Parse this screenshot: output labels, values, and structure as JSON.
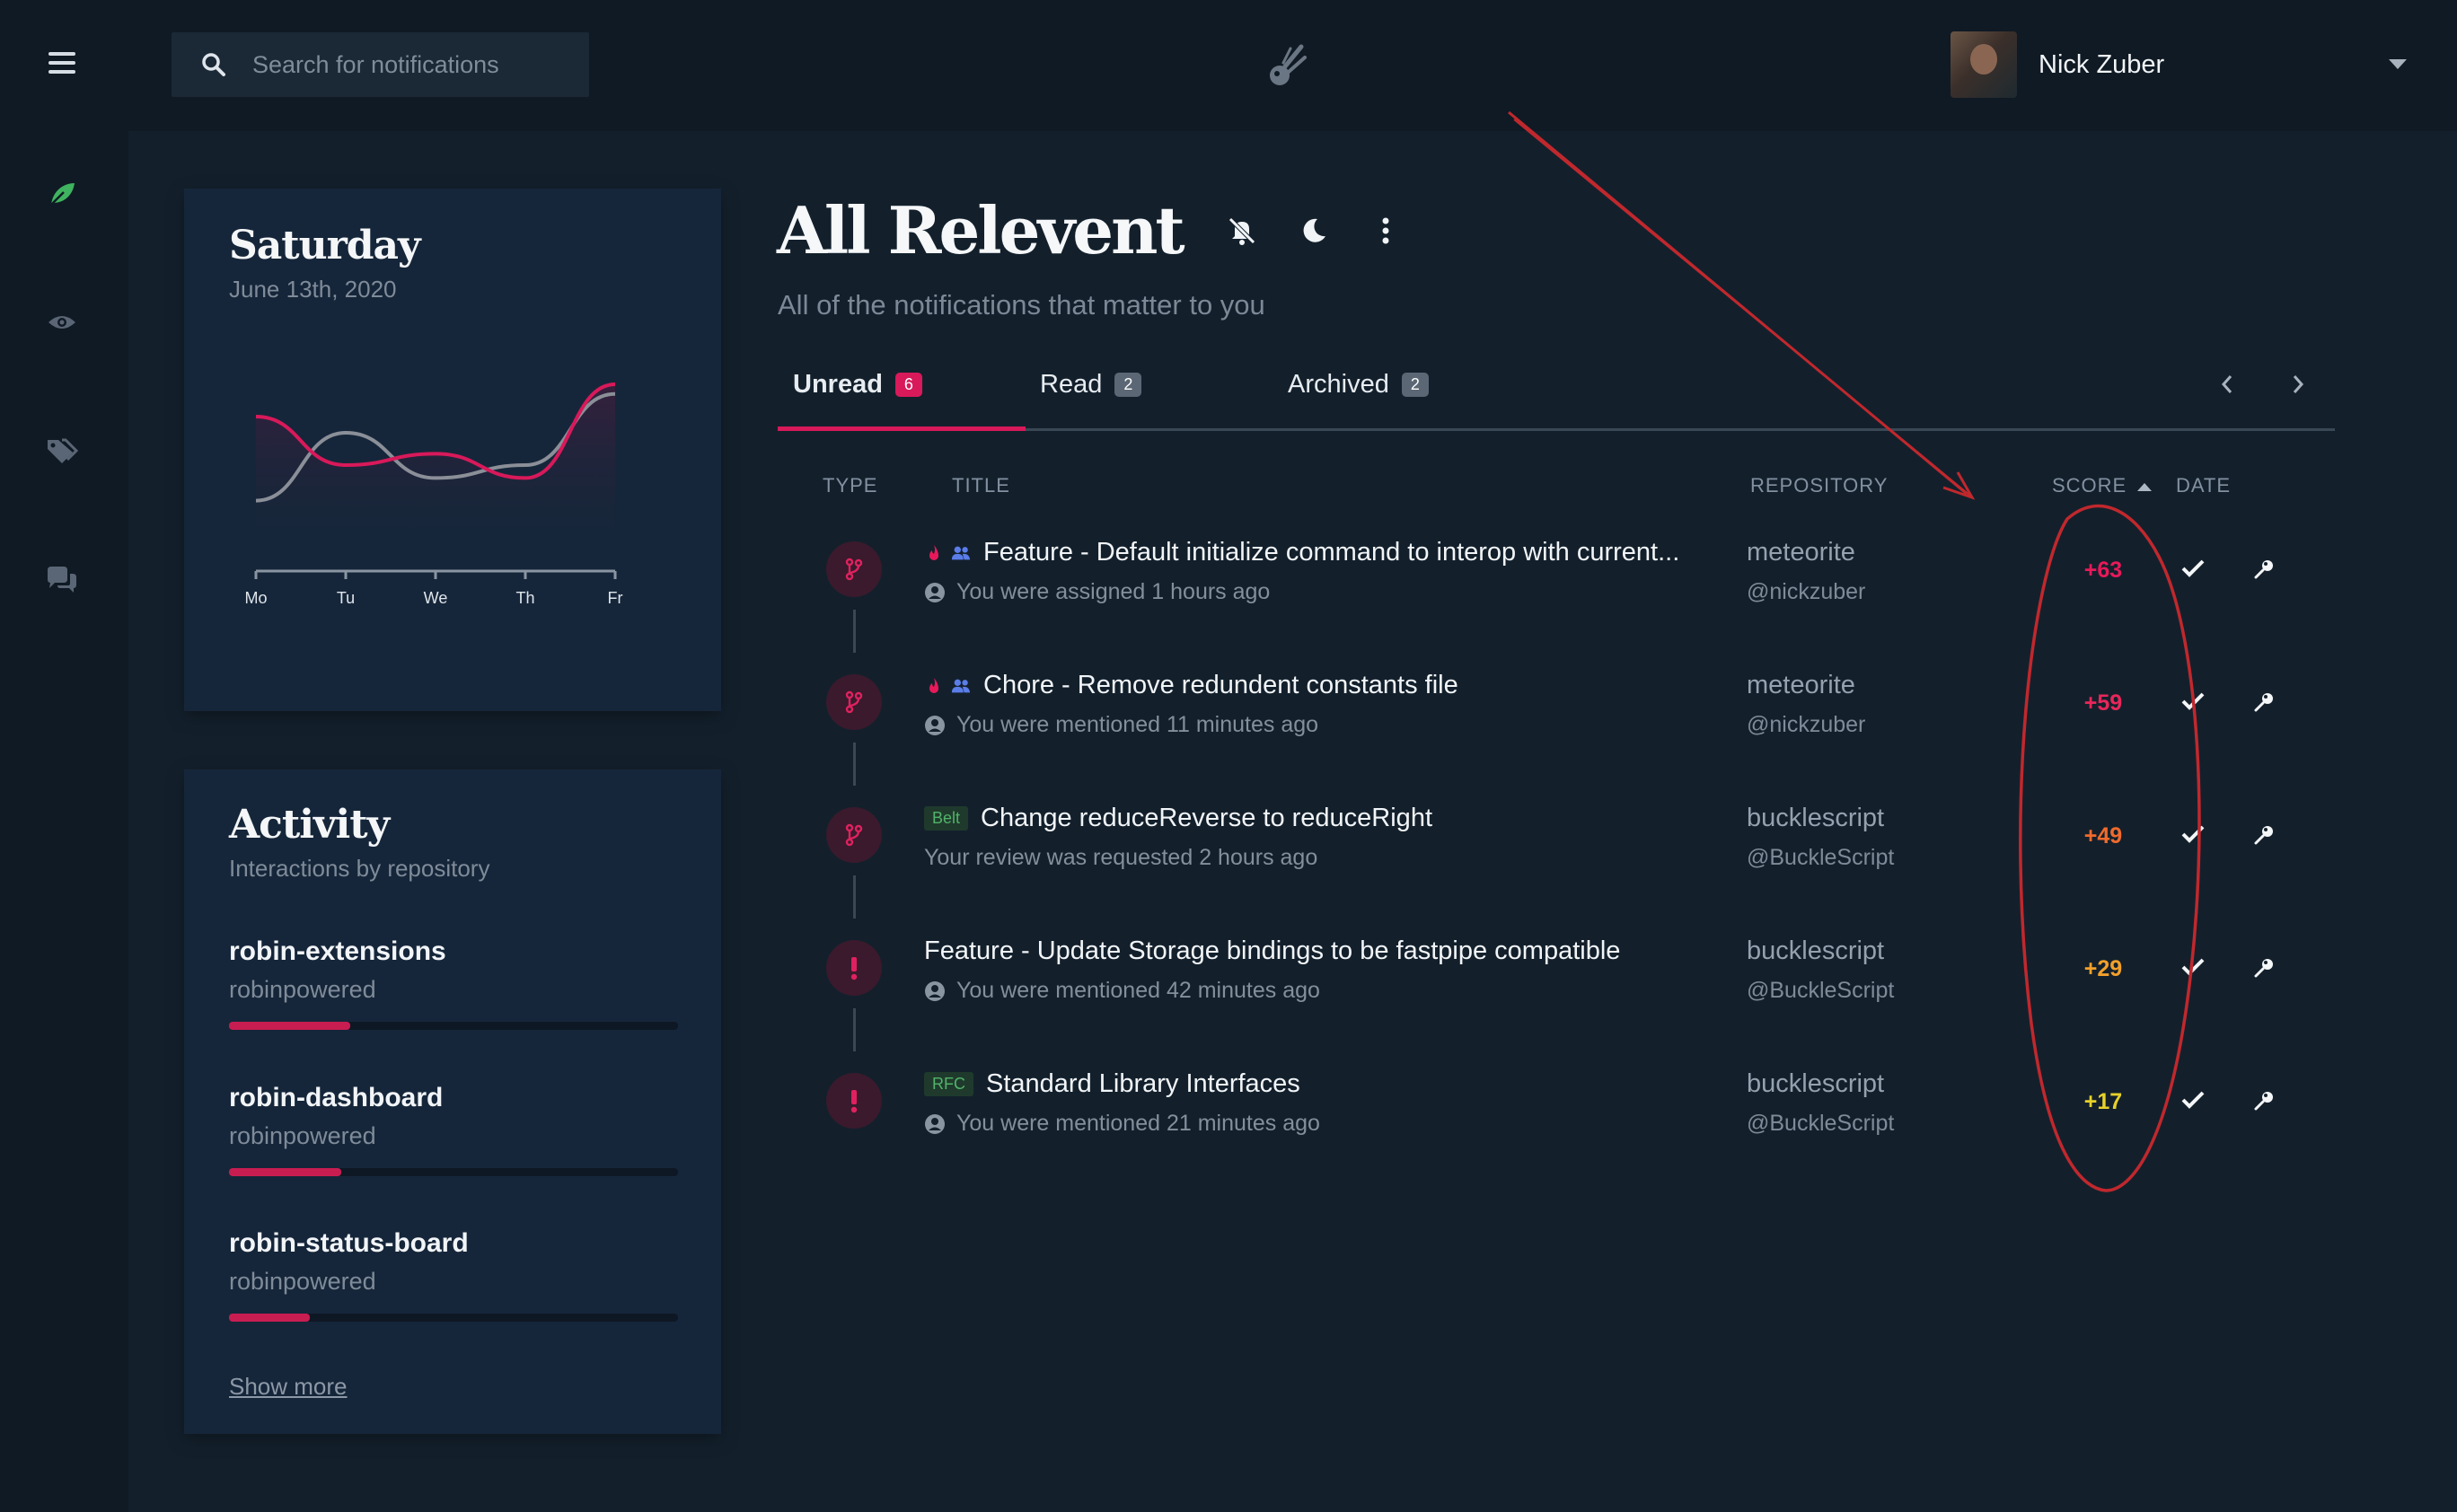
{
  "search": {
    "placeholder": "Search for notifications"
  },
  "user": {
    "name": "Nick Zuber"
  },
  "sidebar": {
    "icons": [
      "menu-icon",
      "leaf-icon",
      "eye-icon",
      "tags-icon",
      "chat-icon"
    ]
  },
  "weekday_card": {
    "day": "Saturday",
    "date": "June 13th, 2020",
    "chart_data": {
      "type": "line",
      "categories": [
        "Mo",
        "Tu",
        "We",
        "Th",
        "Fr"
      ],
      "series": [
        {
          "color": "#d8195a",
          "values": [
            70,
            40,
            47,
            32,
            90
          ]
        },
        {
          "color": "#8a8f98",
          "values": [
            18,
            60,
            32,
            40,
            84
          ]
        }
      ]
    }
  },
  "activity": {
    "title": "Activity",
    "subtitle": "Interactions by repository",
    "repos": [
      {
        "name": "robin-extensions",
        "org": "robinpowered",
        "progress": 0.27
      },
      {
        "name": "robin-dashboard",
        "org": "robinpowered",
        "progress": 0.25
      },
      {
        "name": "robin-status-board",
        "org": "robinpowered",
        "progress": 0.18
      }
    ],
    "show_more": "Show more"
  },
  "main": {
    "title": "All Relevent",
    "subtitle": "All of the notifications that matter to you",
    "tabs": [
      {
        "label": "Unread",
        "count": "6"
      },
      {
        "label": "Read",
        "count": "2"
      },
      {
        "label": "Archived",
        "count": "2"
      }
    ],
    "columns": {
      "type": "TYPE",
      "title": "TITLE",
      "repository": "REPOSITORY",
      "score": "SCORE",
      "date": "DATE"
    },
    "rows": [
      {
        "type": "pull-request",
        "hot": true,
        "team": true,
        "tag": "",
        "title": "Feature - Default initialize command to interop with current...",
        "meta": "You were assigned 1 hours ago",
        "person": true,
        "repo": "meteorite",
        "owner": "@nickzuber",
        "score": "+63",
        "score_color": "#e8195a"
      },
      {
        "type": "pull-request",
        "hot": true,
        "team": true,
        "tag": "",
        "title": "Chore - Remove redundent constants file",
        "meta": "You were mentioned 11 minutes ago",
        "person": true,
        "repo": "meteorite",
        "owner": "@nickzuber",
        "score": "+59",
        "score_color": "#e8275a"
      },
      {
        "type": "pull-request",
        "hot": false,
        "team": false,
        "tag": "Belt",
        "title": "Change reduceReverse to reduceRight",
        "meta": "Your review was requested 2 hours ago",
        "person": false,
        "repo": "bucklescript",
        "owner": "@BuckleScript",
        "score": "+49",
        "score_color": "#f06a2c"
      },
      {
        "type": "issue",
        "hot": false,
        "team": false,
        "tag": "",
        "title": "Feature - Update Storage bindings to be fastpipe compatible",
        "meta": "You were mentioned 42 minutes ago",
        "person": true,
        "repo": "bucklescript",
        "owner": "@BuckleScript",
        "score": "+29",
        "score_color": "#f3a02a"
      },
      {
        "type": "issue",
        "hot": false,
        "team": false,
        "tag": "RFC",
        "title": "Standard Library Interfaces",
        "meta": "You were mentioned 21 minutes ago",
        "person": true,
        "repo": "bucklescript",
        "owner": "@BuckleScript",
        "score": "+17",
        "score_color": "#e7d12a"
      }
    ]
  },
  "colors": {
    "accent": "#d8195a",
    "annotation": "#c0282d"
  }
}
